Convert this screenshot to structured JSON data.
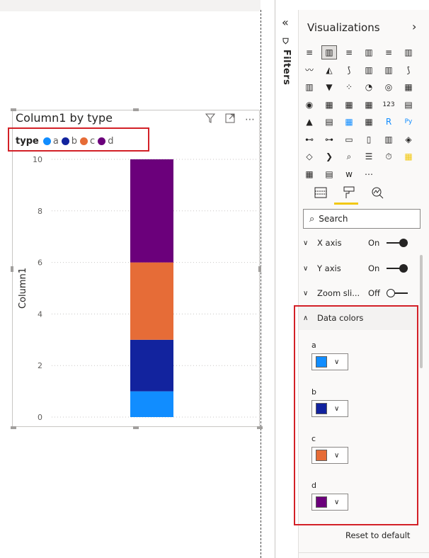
{
  "visual": {
    "title": "Column1 by type",
    "legend_title": "type",
    "legend": [
      {
        "name": "a",
        "color": "#118dff"
      },
      {
        "name": "b",
        "color": "#12239e"
      },
      {
        "name": "c",
        "color": "#e66c37"
      },
      {
        "name": "d",
        "color": "#6b007b"
      }
    ],
    "icons": [
      "filter-icon",
      "focus-mode-icon",
      "more-options-icon"
    ]
  },
  "chart_data": {
    "type": "bar",
    "stacked": true,
    "categories": [
      ""
    ],
    "series": [
      {
        "name": "a",
        "values": [
          1
        ],
        "color": "#118dff"
      },
      {
        "name": "b",
        "values": [
          2
        ],
        "color": "#12239e"
      },
      {
        "name": "c",
        "values": [
          3
        ],
        "color": "#e66c37"
      },
      {
        "name": "d",
        "values": [
          4
        ],
        "color": "#6b007b"
      }
    ],
    "ylabel": "Column1",
    "xlabel": "",
    "ylim": [
      0,
      10
    ],
    "yticks": [
      "0",
      "2",
      "4",
      "6",
      "8",
      "10"
    ],
    "grid": true
  },
  "filters": {
    "label": "Filters",
    "collapse_icon": "double-chevron-left-icon"
  },
  "viz_pane": {
    "title": "Visualizations",
    "expand_icon": "chevron-right-icon",
    "icon_glyphs": [
      "≡",
      "▥",
      "≡",
      "▥",
      "≡",
      "▥",
      "〰",
      "◭",
      "⟆",
      "▥",
      "▥",
      "⟆",
      "▥",
      "▼",
      "⁘",
      "◔",
      "◎",
      "▦",
      "◉",
      "▦",
      "▦",
      "▦",
      "123",
      "▤",
      "▲",
      "▤",
      "▦",
      "▦",
      "R",
      "Py",
      "⊷",
      "⊶",
      "▭",
      "▯",
      "▥",
      "◈",
      "◇",
      "❯",
      "⌕",
      "☰",
      "⏱",
      "▦",
      "▦",
      "▤",
      "w",
      "⋯"
    ],
    "tabs": [
      "fields-icon",
      "format-icon",
      "analytics-icon"
    ],
    "search_placeholder": "Search",
    "cards": [
      {
        "label": "X axis",
        "state": "On"
      },
      {
        "label": "Y axis",
        "state": "On"
      },
      {
        "label": "Zoom sli...",
        "state": "Off"
      }
    ],
    "data_colors": {
      "header": "Data colors",
      "items": [
        {
          "label": "a",
          "color": "#118dff"
        },
        {
          "label": "b",
          "color": "#12239e"
        },
        {
          "label": "c",
          "color": "#e66c37"
        },
        {
          "label": "d",
          "color": "#6b007b"
        }
      ],
      "reset": "Reset to default"
    }
  }
}
